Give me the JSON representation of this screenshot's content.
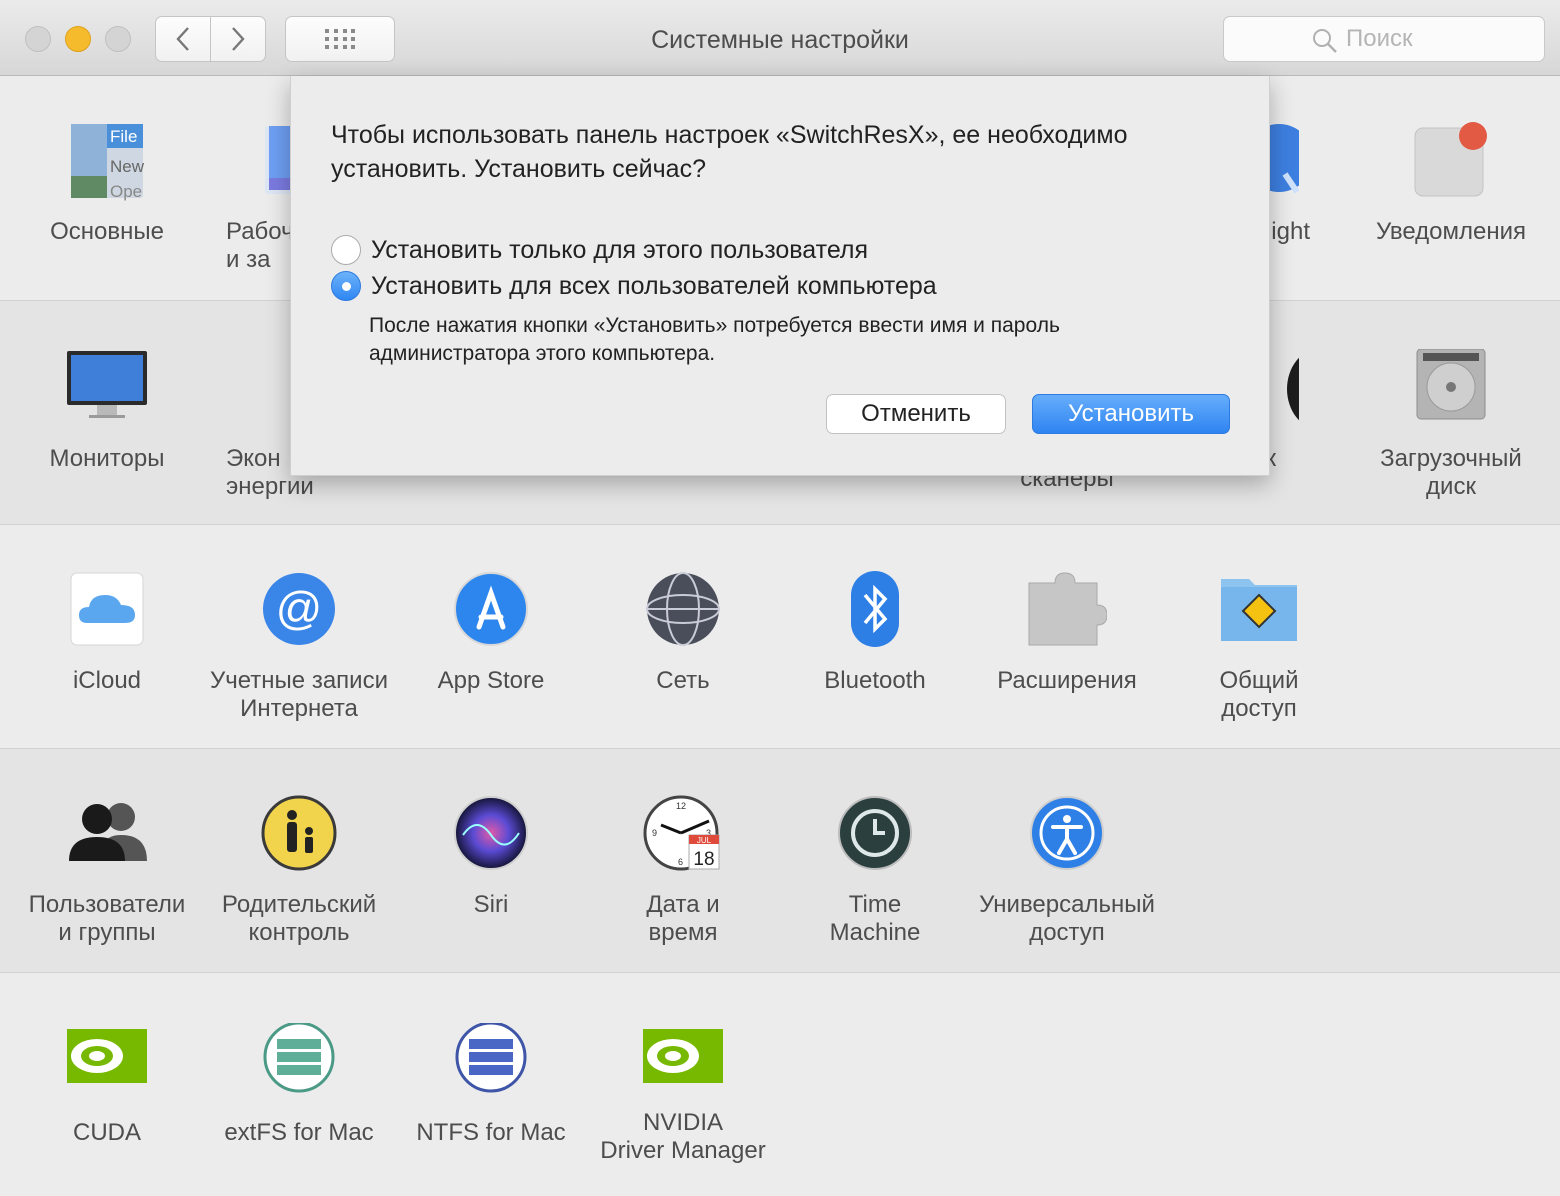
{
  "window": {
    "title": "Системные настройки",
    "search_placeholder": "Поиск"
  },
  "rows": [
    {
      "panes": [
        {
          "label": "Основные",
          "icon": "general-icon"
        },
        {
          "label": "Рабоч\nи за",
          "icon": "desktop-icon"
        },
        {
          "label": "ight",
          "icon": "spotlight-icon"
        },
        {
          "label": "Уведомления",
          "icon": "notifications-icon"
        }
      ]
    },
    {
      "panes": [
        {
          "label": "Мониторы",
          "icon": "displays-icon"
        },
        {
          "label": "Экон\nэнергии",
          "icon": "energy-icon"
        },
        {
          "label": "сканеры",
          "icon": "printers-icon"
        },
        {
          "label": "ук",
          "icon": "mouse-icon"
        },
        {
          "label": "Загрузочный\nдиск",
          "icon": "startup-disk-icon"
        }
      ]
    },
    {
      "panes": [
        {
          "label": "iCloud",
          "icon": "icloud-icon"
        },
        {
          "label": "Учетные записи\nИнтернета",
          "icon": "internet-accounts-icon"
        },
        {
          "label": "App Store",
          "icon": "app-store-icon"
        },
        {
          "label": "Сеть",
          "icon": "network-icon"
        },
        {
          "label": "Bluetooth",
          "icon": "bluetooth-icon"
        },
        {
          "label": "Расширения",
          "icon": "extensions-icon"
        },
        {
          "label": "Общий\nдоступ",
          "icon": "sharing-icon"
        }
      ]
    },
    {
      "panes": [
        {
          "label": "Пользователи\nи группы",
          "icon": "users-icon"
        },
        {
          "label": "Родительский\nконтроль",
          "icon": "parental-controls-icon"
        },
        {
          "label": "Siri",
          "icon": "siri-icon"
        },
        {
          "label": "Дата и\nвремя",
          "icon": "date-time-icon"
        },
        {
          "label": "Time\nMachine",
          "icon": "time-machine-icon"
        },
        {
          "label": "Универсальный\nдоступ",
          "icon": "accessibility-icon"
        }
      ]
    },
    {
      "panes": [
        {
          "label": "CUDA",
          "icon": "cuda-icon"
        },
        {
          "label": "extFS for Mac",
          "icon": "extfs-icon"
        },
        {
          "label": "NTFS for Mac",
          "icon": "ntfs-icon"
        },
        {
          "label": "NVIDIA\nDriver Manager",
          "icon": "nvidia-icon"
        }
      ]
    }
  ],
  "general_icon_text": {
    "line1": "File",
    "line2": "New",
    "line3": "Ope"
  },
  "date_icon_text": {
    "month": "JUL",
    "day": "18",
    "n12": "12",
    "n9": "9",
    "n3": "3",
    "n6": "6"
  },
  "dialog": {
    "message": "Чтобы использовать панель настроек «SwitchResX», ее необходимо установить. Установить сейчас?",
    "option_current_user": "Установить только для этого пользователя",
    "option_all_users": "Установить для всех пользователей компьютера",
    "selected_option": "all_users",
    "hint": "После нажатия кнопки «Установить» потребуется ввести имя и пароль администратора этого компьютера.",
    "cancel_label": "Отменить",
    "install_label": "Установить"
  },
  "colors": {
    "accent": "#3b8ef5",
    "nvidia_green": "#76b900",
    "notification_badge": "#e25a43"
  }
}
